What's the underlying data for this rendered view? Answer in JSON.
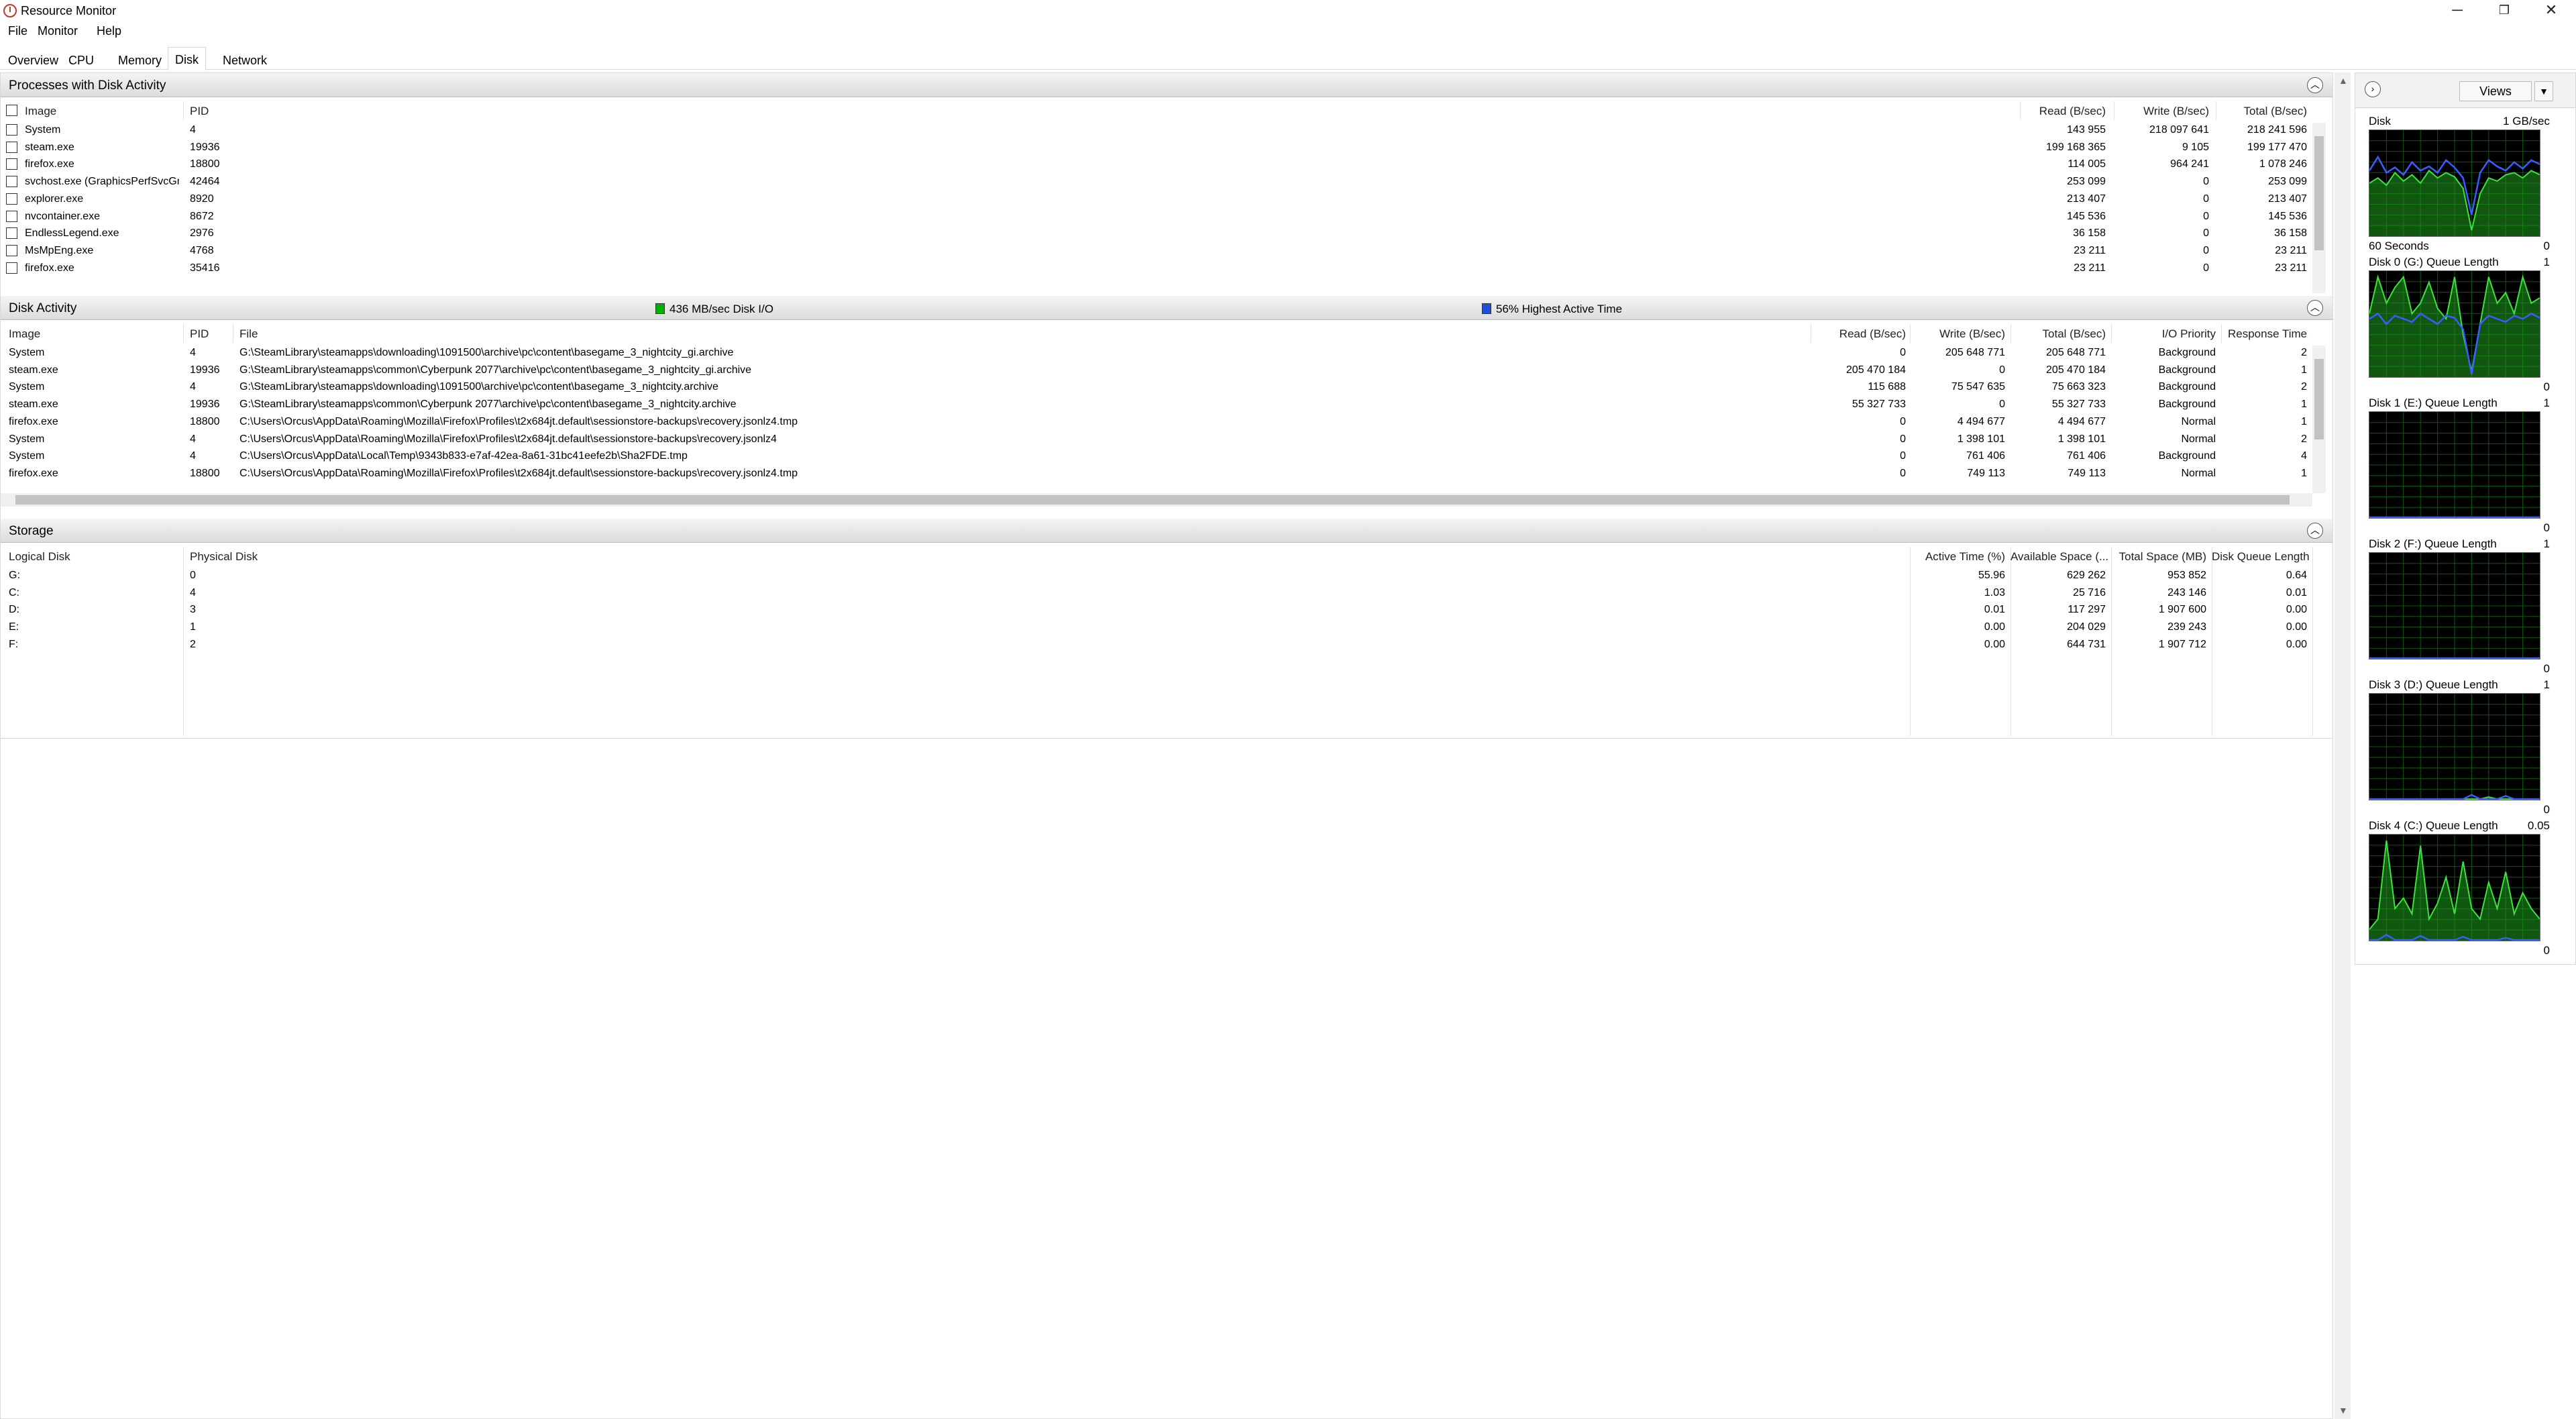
{
  "window": {
    "title": "Resource Monitor",
    "minimize": "─",
    "restore": "❐",
    "close": "✕"
  },
  "menu": [
    "File",
    "Monitor",
    "Help"
  ],
  "tabs": [
    "Overview",
    "CPU",
    "Memory",
    "Disk",
    "Network"
  ],
  "active_tab": "Disk",
  "processes": {
    "title": "Processes with Disk Activity",
    "columns": {
      "image": "Image",
      "pid": "PID",
      "read": "Read (B/sec)",
      "write": "Write (B/sec)",
      "total": "Total (B/sec)"
    },
    "rows": [
      {
        "image": "System",
        "pid": "4",
        "read": "143 955",
        "write": "218 097 641",
        "total": "218 241 596"
      },
      {
        "image": "steam.exe",
        "pid": "19936",
        "read": "199 168 365",
        "write": "9 105",
        "total": "199 177 470"
      },
      {
        "image": "firefox.exe",
        "pid": "18800",
        "read": "114 005",
        "write": "964 241",
        "total": "1 078 246"
      },
      {
        "image": "svchost.exe (GraphicsPerfSvcGr...",
        "pid": "42464",
        "read": "253 099",
        "write": "0",
        "total": "253 099"
      },
      {
        "image": "explorer.exe",
        "pid": "8920",
        "read": "213 407",
        "write": "0",
        "total": "213 407"
      },
      {
        "image": "nvcontainer.exe",
        "pid": "8672",
        "read": "145 536",
        "write": "0",
        "total": "145 536"
      },
      {
        "image": "EndlessLegend.exe",
        "pid": "2976",
        "read": "36 158",
        "write": "0",
        "total": "36 158"
      },
      {
        "image": "MsMpEng.exe",
        "pid": "4768",
        "read": "23 211",
        "write": "0",
        "total": "23 211"
      },
      {
        "image": "firefox.exe",
        "pid": "35416",
        "read": "23 211",
        "write": "0",
        "total": "23 211"
      }
    ]
  },
  "disk_activity": {
    "title": "Disk Activity",
    "io_summary": "436 MB/sec Disk I/O",
    "active_summary": "56% Highest Active Time",
    "io_color": "#00b000",
    "active_color": "#1f4fd6",
    "columns": {
      "image": "Image",
      "pid": "PID",
      "file": "File",
      "read": "Read (B/sec)",
      "write": "Write (B/sec)",
      "total": "Total (B/sec)",
      "priority": "I/O Priority",
      "response": "Response Time (..."
    },
    "rows": [
      {
        "image": "System",
        "pid": "4",
        "file": "G:\\SteamLibrary\\steamapps\\downloading\\1091500\\archive\\pc\\content\\basegame_3_nightcity_gi.archive",
        "read": "0",
        "write": "205 648 771",
        "total": "205 648 771",
        "priority": "Background",
        "response": "2"
      },
      {
        "image": "steam.exe",
        "pid": "19936",
        "file": "G:\\SteamLibrary\\steamapps\\common\\Cyberpunk 2077\\archive\\pc\\content\\basegame_3_nightcity_gi.archive",
        "read": "205 470 184",
        "write": "0",
        "total": "205 470 184",
        "priority": "Background",
        "response": "1"
      },
      {
        "image": "System",
        "pid": "4",
        "file": "G:\\SteamLibrary\\steamapps\\downloading\\1091500\\archive\\pc\\content\\basegame_3_nightcity.archive",
        "read": "115 688",
        "write": "75 547 635",
        "total": "75 663 323",
        "priority": "Background",
        "response": "2"
      },
      {
        "image": "steam.exe",
        "pid": "19936",
        "file": "G:\\SteamLibrary\\steamapps\\common\\Cyberpunk 2077\\archive\\pc\\content\\basegame_3_nightcity.archive",
        "read": "55 327 733",
        "write": "0",
        "total": "55 327 733",
        "priority": "Background",
        "response": "1"
      },
      {
        "image": "firefox.exe",
        "pid": "18800",
        "file": "C:\\Users\\Orcus\\AppData\\Roaming\\Mozilla\\Firefox\\Profiles\\t2x684jt.default\\sessionstore-backups\\recovery.jsonlz4.tmp",
        "read": "0",
        "write": "4 494 677",
        "total": "4 494 677",
        "priority": "Normal",
        "response": "1"
      },
      {
        "image": "System",
        "pid": "4",
        "file": "C:\\Users\\Orcus\\AppData\\Roaming\\Mozilla\\Firefox\\Profiles\\t2x684jt.default\\sessionstore-backups\\recovery.jsonlz4",
        "read": "0",
        "write": "1 398 101",
        "total": "1 398 101",
        "priority": "Normal",
        "response": "2"
      },
      {
        "image": "System",
        "pid": "4",
        "file": "C:\\Users\\Orcus\\AppData\\Local\\Temp\\9343b833-e7af-42ea-8a61-31bc41eefe2b\\Sha2FDE.tmp",
        "read": "0",
        "write": "761 406",
        "total": "761 406",
        "priority": "Background",
        "response": "4"
      },
      {
        "image": "firefox.exe",
        "pid": "18800",
        "file": "C:\\Users\\Orcus\\AppData\\Roaming\\Mozilla\\Firefox\\Profiles\\t2x684jt.default\\sessionstore-backups\\recovery.jsonlz4.tmp",
        "read": "0",
        "write": "749 113",
        "total": "749 113",
        "priority": "Normal",
        "response": "1"
      }
    ]
  },
  "storage": {
    "title": "Storage",
    "columns": {
      "logical": "Logical Disk",
      "physical": "Physical Disk",
      "active": "Active Time (%)",
      "available": "Available Space (...",
      "total": "Total Space (MB)",
      "queue": "Disk Queue Length"
    },
    "rows": [
      {
        "logical": "G:",
        "physical": "0",
        "active": "55.96",
        "available": "629 262",
        "total": "953 852",
        "queue": "0.64"
      },
      {
        "logical": "C:",
        "physical": "4",
        "active": "1.03",
        "available": "25 716",
        "total": "243 146",
        "queue": "0.01"
      },
      {
        "logical": "D:",
        "physical": "3",
        "active": "0.01",
        "available": "117 297",
        "total": "1 907 600",
        "queue": "0.00"
      },
      {
        "logical": "E:",
        "physical": "1",
        "active": "0.00",
        "available": "204 029",
        "total": "239 243",
        "queue": "0.00"
      },
      {
        "logical": "F:",
        "physical": "2",
        "active": "0.00",
        "available": "644 731",
        "total": "1 907 712",
        "queue": "0.00"
      }
    ]
  },
  "right_panel": {
    "views_label": "Views",
    "graphs": [
      {
        "title": "Disk",
        "max": "1 GB/sec",
        "min": "0",
        "footer": "60 Seconds",
        "green": [
          0.5,
          0.55,
          0.48,
          0.6,
          0.52,
          0.58,
          0.5,
          0.62,
          0.55,
          0.6,
          0.56,
          0.45,
          0.05,
          0.4,
          0.55,
          0.52,
          0.58,
          0.6,
          0.55,
          0.62,
          0.58
        ],
        "blue": [
          0.62,
          0.75,
          0.6,
          0.65,
          0.58,
          0.7,
          0.62,
          0.66,
          0.6,
          0.72,
          0.65,
          0.55,
          0.2,
          0.6,
          0.72,
          0.66,
          0.62,
          0.7,
          0.64,
          0.72,
          0.68
        ]
      },
      {
        "title": "Disk 0 (G:) Queue Length",
        "max": "1",
        "min": "0",
        "footer": "",
        "green": [
          0.6,
          0.95,
          0.7,
          0.85,
          0.95,
          0.6,
          0.7,
          0.9,
          0.65,
          0.55,
          0.95,
          0.4,
          0.05,
          0.5,
          0.95,
          0.7,
          0.8,
          0.6,
          0.95,
          0.7,
          0.75
        ],
        "blue": [
          0.55,
          0.6,
          0.5,
          0.58,
          0.55,
          0.52,
          0.6,
          0.55,
          0.5,
          0.58,
          0.56,
          0.45,
          0.02,
          0.5,
          0.58,
          0.55,
          0.52,
          0.58,
          0.55,
          0.6,
          0.56
        ]
      },
      {
        "title": "Disk 1 (E:) Queue Length",
        "max": "1",
        "min": "0",
        "footer": "",
        "green": [
          0,
          0,
          0,
          0,
          0,
          0,
          0,
          0,
          0,
          0,
          0,
          0,
          0,
          0,
          0,
          0,
          0,
          0,
          0,
          0,
          0
        ],
        "blue": [
          0,
          0,
          0,
          0,
          0,
          0,
          0,
          0,
          0,
          0,
          0,
          0,
          0,
          0,
          0,
          0,
          0,
          0,
          0,
          0,
          0
        ]
      },
      {
        "title": "Disk 2 (F:) Queue Length",
        "max": "1",
        "min": "0",
        "footer": "",
        "green": [
          0,
          0,
          0,
          0,
          0,
          0,
          0,
          0,
          0,
          0,
          0,
          0,
          0,
          0,
          0,
          0,
          0,
          0,
          0,
          0,
          0
        ],
        "blue": [
          0,
          0,
          0,
          0,
          0,
          0,
          0,
          0,
          0,
          0,
          0,
          0,
          0,
          0,
          0,
          0,
          0,
          0,
          0,
          0,
          0
        ]
      },
      {
        "title": "Disk 3 (D:) Queue Length",
        "max": "1",
        "min": "0",
        "footer": "",
        "green": [
          0,
          0,
          0,
          0,
          0,
          0,
          0,
          0,
          0,
          0,
          0,
          0,
          0,
          0,
          0.02,
          0,
          0,
          0,
          0,
          0,
          0
        ],
        "blue": [
          0,
          0,
          0,
          0,
          0,
          0,
          0,
          0,
          0,
          0,
          0,
          0,
          0.04,
          0,
          0,
          0,
          0.03,
          0,
          0,
          0,
          0
        ]
      },
      {
        "title": "Disk 4 (C:) Queue Length",
        "max": "0.05",
        "min": "0",
        "footer": "",
        "green": [
          0.1,
          0.2,
          0.95,
          0.3,
          0.4,
          0.25,
          0.9,
          0.2,
          0.35,
          0.6,
          0.25,
          0.75,
          0.3,
          0.2,
          0.55,
          0.3,
          0.65,
          0.25,
          0.45,
          0.3,
          0.2
        ],
        "blue": [
          0,
          0,
          0.05,
          0,
          0,
          0,
          0.04,
          0,
          0,
          0,
          0,
          0.03,
          0,
          0,
          0,
          0,
          0.02,
          0,
          0,
          0,
          0
        ]
      }
    ]
  }
}
